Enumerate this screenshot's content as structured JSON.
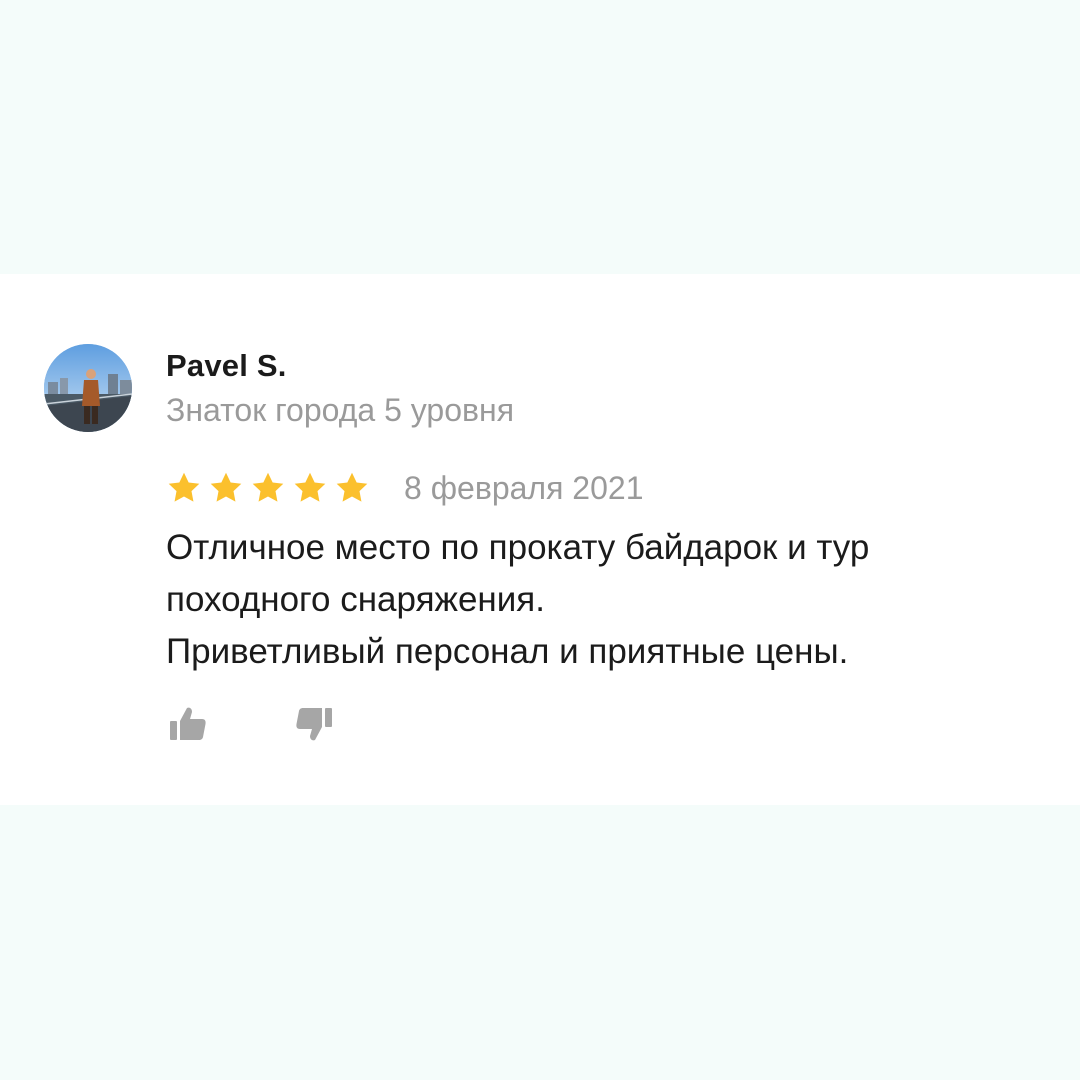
{
  "review": {
    "author": {
      "name": "Pavel S.",
      "level": "Знаток города 5 уровня",
      "avatar_icon": "user-photo-avatar"
    },
    "rating": 5,
    "rating_max": 5,
    "star_color": "#fbc02d",
    "date": "8 февраля 2021",
    "text_lines": [
      "Отличное место по прокату байдарок и тур",
      "походного снаряжения.",
      "Приветливый персонал и приятные цены."
    ],
    "actions": {
      "like_icon": "thumbs-up-icon",
      "dislike_icon": "thumbs-down-icon",
      "icon_color": "#a6a6a6"
    }
  },
  "colors": {
    "page_background": "#f4fcfa",
    "card_background": "#ffffff",
    "primary_text": "#1b1b1b",
    "secondary_text": "#9a9a9a"
  }
}
